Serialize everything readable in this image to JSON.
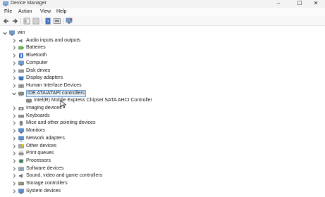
{
  "window": {
    "title": "Device Manager",
    "minimize": "–",
    "maximize": "☐",
    "close": "✕"
  },
  "menu": {
    "file": "File",
    "action": "Action",
    "view": "View",
    "help": "Help"
  },
  "toolbar": {
    "icons": [
      "back-arrow-icon",
      "forward-arrow-icon",
      "properties-icon",
      "console-tree-icon",
      "help-icon",
      "device-view-icon",
      "monitor-icon"
    ]
  },
  "tree": {
    "root": "win",
    "items": [
      {
        "label": "Audio inputs and outputs",
        "icon": "speaker-icon"
      },
      {
        "label": "Batteries",
        "icon": "battery-icon"
      },
      {
        "label": "Bluetooth",
        "icon": "bluetooth-icon"
      },
      {
        "label": "Computer",
        "icon": "computer-icon"
      },
      {
        "label": "Disk drives",
        "icon": "disk-icon"
      },
      {
        "label": "Display adapters",
        "icon": "display-adapter-icon"
      },
      {
        "label": "Human Interface Devices",
        "icon": "hid-icon"
      },
      {
        "label": "IDE ATA/ATAPI controllers",
        "icon": "ide-controller-icon",
        "expanded": true,
        "selected": true,
        "children": [
          {
            "label": "Intel(R) Mobile Express Chipset SATA AHCI Controller",
            "icon": "ide-controller-icon"
          }
        ]
      },
      {
        "label": "Imaging devices",
        "icon": "camera-icon"
      },
      {
        "label": "Keyboards",
        "icon": "keyboard-icon"
      },
      {
        "label": "Mice and other pointing devices",
        "icon": "mouse-icon"
      },
      {
        "label": "Monitors",
        "icon": "monitor-icon"
      },
      {
        "label": "Network adapters",
        "icon": "network-icon"
      },
      {
        "label": "Other devices",
        "icon": "other-devices-icon"
      },
      {
        "label": "Print queues",
        "icon": "printer-icon"
      },
      {
        "label": "Processors",
        "icon": "processor-icon"
      },
      {
        "label": "Software devices",
        "icon": "software-device-icon"
      },
      {
        "label": "Sound, video and game controllers",
        "icon": "sound-icon"
      },
      {
        "label": "Storage controllers",
        "icon": "storage-icon"
      },
      {
        "label": "System devices",
        "icon": "system-devices-icon"
      }
    ]
  },
  "colors": {
    "selection_fill": "#e5f1fb",
    "selection_border": "#6a9ed6",
    "accent_icon": "#3f7cc8"
  }
}
